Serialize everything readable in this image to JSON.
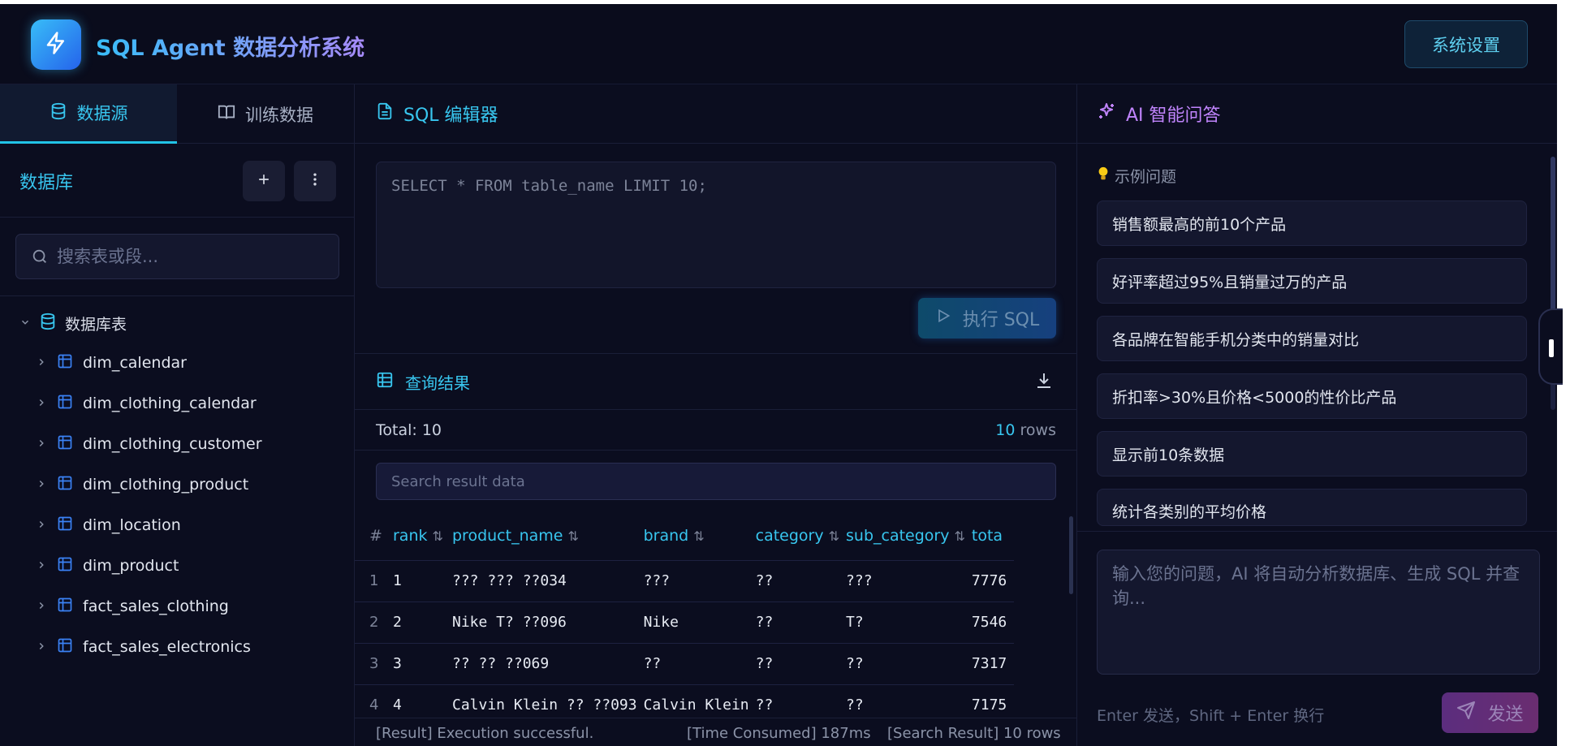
{
  "header": {
    "app_title": "SQL Agent 数据分析系统",
    "settings_label": "系统设置",
    "logo_icon": "lightning-icon"
  },
  "sidebar": {
    "tabs": [
      {
        "label": "数据源",
        "icon": "database-icon",
        "active": true
      },
      {
        "label": "训练数据",
        "icon": "book-icon",
        "active": false
      }
    ],
    "database_title": "数据库",
    "search_placeholder": "搜索表或段...",
    "tree": {
      "root_label": "数据库表",
      "tables": [
        "dim_calendar",
        "dim_clothing_calendar",
        "dim_clothing_customer",
        "dim_clothing_product",
        "dim_location",
        "dim_product",
        "fact_sales_clothing",
        "fact_sales_electronics"
      ]
    }
  },
  "editor": {
    "title": "SQL 编辑器",
    "placeholder": "SELECT * FROM table_name LIMIT 10;",
    "run_label": "执行 SQL"
  },
  "results": {
    "title": "查询结果",
    "total_label": "Total: 10",
    "row_count": "10",
    "rows_suffix": "rows",
    "search_placeholder": "Search result data",
    "columns": [
      "#",
      "rank",
      "product_name",
      "brand",
      "category",
      "sub_category",
      "tota"
    ],
    "rows": [
      [
        "1",
        "1",
        "??? ??? ??034",
        "???",
        "??",
        "???",
        "7776"
      ],
      [
        "2",
        "2",
        "Nike T? ??096",
        "Nike",
        "??",
        "T?",
        "7546"
      ],
      [
        "3",
        "3",
        "?? ?? ??069",
        "??",
        "??",
        "??",
        "7317"
      ],
      [
        "4",
        "4",
        "Calvin Klein ?? ??093",
        "Calvin Klein",
        "??",
        "??",
        "7175"
      ]
    ],
    "status": {
      "result": "[Result] Execution successful.",
      "time": "[Time Consumed] 187ms",
      "search": "[Search Result] 10 rows"
    }
  },
  "ai": {
    "title": "AI 智能问答",
    "examples_title": "示例问题",
    "examples": [
      "销售额最高的前10个产品",
      "好评率超过95%且销量过万的产品",
      "各品牌在智能手机分类中的销量对比",
      "折扣率>30%且价格<5000的性价比产品",
      "显示前10条数据",
      "统计各类别的平均价格"
    ],
    "input_placeholder": "输入您的问题，AI 将自动分析数据库、生成 SQL 并查询...",
    "hint": "Enter 发送，Shift + Enter 换行",
    "send_label": "发送"
  },
  "colors": {
    "background": "#0b0d1f",
    "accent_cyan": "#38c6ef",
    "accent_purple": "#c084fc"
  }
}
